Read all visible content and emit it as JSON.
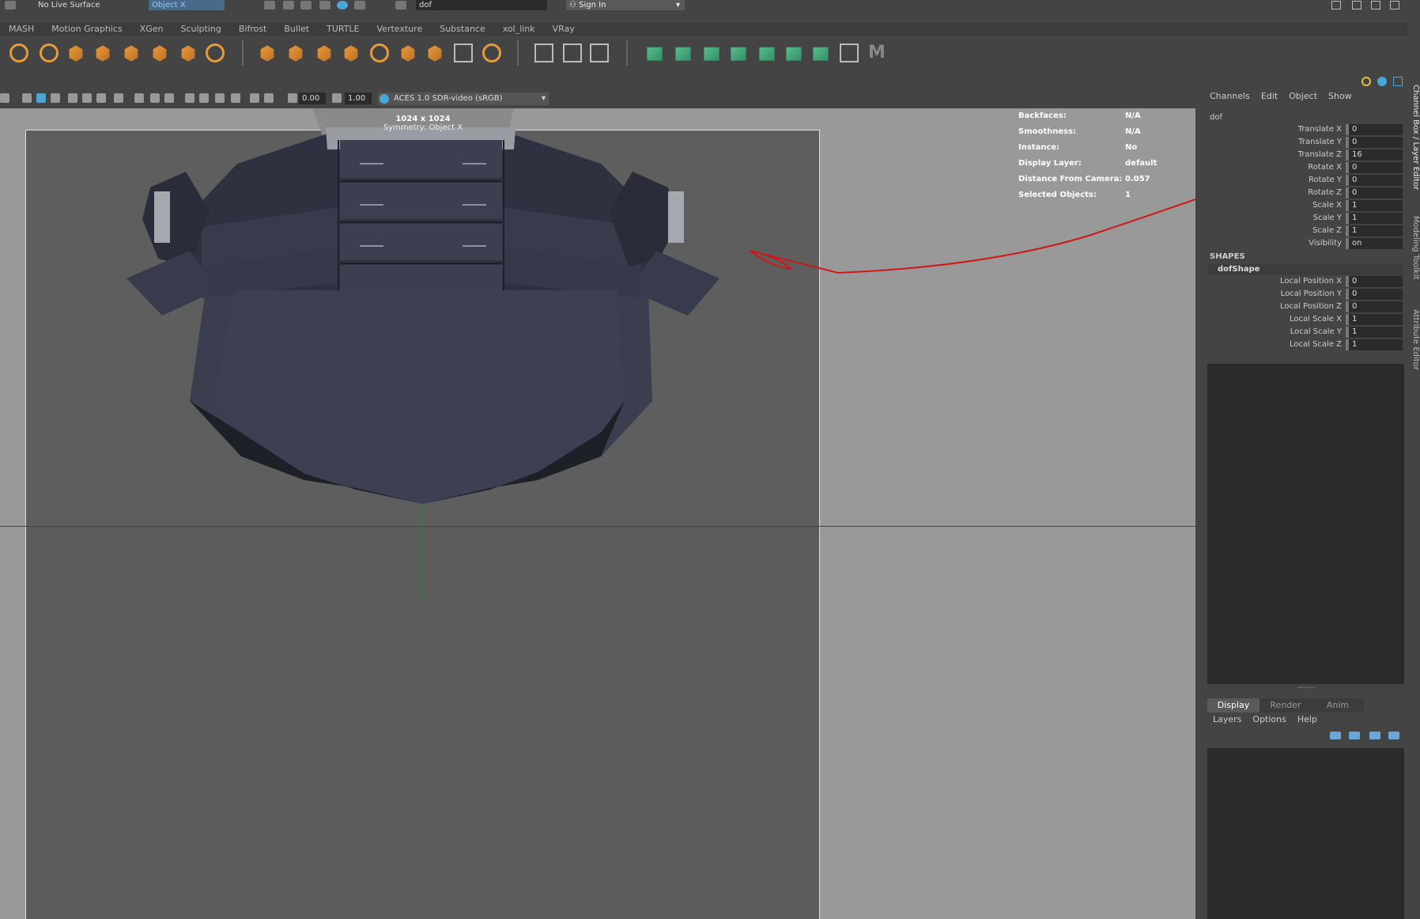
{
  "status_line": {
    "live_surface_label": "No Live Surface",
    "symmetry_value": "Object X",
    "name_field_value": "dof",
    "sign_in_label": "Sign In"
  },
  "shelf_tabs": [
    "MASH",
    "Motion Graphics",
    "XGen",
    "Sculpting",
    "Bifrost",
    "Bullet",
    "TURTLE",
    "Vertexture",
    "Substance",
    "xol_link",
    "VRay"
  ],
  "panel_toolbar": {
    "exposure_value": "0.00",
    "gamma_value": "1.00",
    "color_space": "ACES 1.0 SDR-video (sRGB)"
  },
  "viewport": {
    "resolution_label": "1024 x 1024",
    "symmetry_hud": "Symmetry: Object X",
    "hud_stats": [
      {
        "label": "Backfaces:",
        "value": "N/A"
      },
      {
        "label": "Smoothness:",
        "value": "N/A"
      },
      {
        "label": "Instance:",
        "value": "No"
      },
      {
        "label": "Display Layer:",
        "value": "default"
      },
      {
        "label": "Distance From Camera:",
        "value": "0.057"
      },
      {
        "label": "Selected Objects:",
        "value": "1"
      }
    ],
    "annotation_color": "#d01818"
  },
  "channel_box": {
    "menu": [
      "Channels",
      "Edit",
      "Object",
      "Show"
    ],
    "node_name": "dof",
    "channels": [
      {
        "label": "Translate X",
        "value": "0"
      },
      {
        "label": "Translate Y",
        "value": "0"
      },
      {
        "label": "Translate Z",
        "value": "16"
      },
      {
        "label": "Rotate X",
        "value": "0"
      },
      {
        "label": "Rotate Y",
        "value": "0"
      },
      {
        "label": "Rotate Z",
        "value": "0"
      },
      {
        "label": "Scale X",
        "value": "1"
      },
      {
        "label": "Scale Y",
        "value": "1"
      },
      {
        "label": "Scale Z",
        "value": "1"
      },
      {
        "label": "Visibility",
        "value": "on"
      }
    ],
    "shapes_header": "SHAPES",
    "shape_node": "dofShape",
    "shape_channels": [
      {
        "label": "Local Position X",
        "value": "0"
      },
      {
        "label": "Local Position Y",
        "value": "0"
      },
      {
        "label": "Local Position Z",
        "value": "0"
      },
      {
        "label": "Local Scale X",
        "value": "1"
      },
      {
        "label": "Local Scale Y",
        "value": "1"
      },
      {
        "label": "Local Scale Z",
        "value": "1"
      }
    ]
  },
  "layer_editor": {
    "tabs": [
      "Display",
      "Render",
      "Anim"
    ],
    "active_tab": "Display",
    "menu": [
      "Layers",
      "Options",
      "Help"
    ]
  },
  "side_tabs": [
    "Channel Box / Layer Editor",
    "Modeling Toolkit",
    "Attribute Editor"
  ]
}
